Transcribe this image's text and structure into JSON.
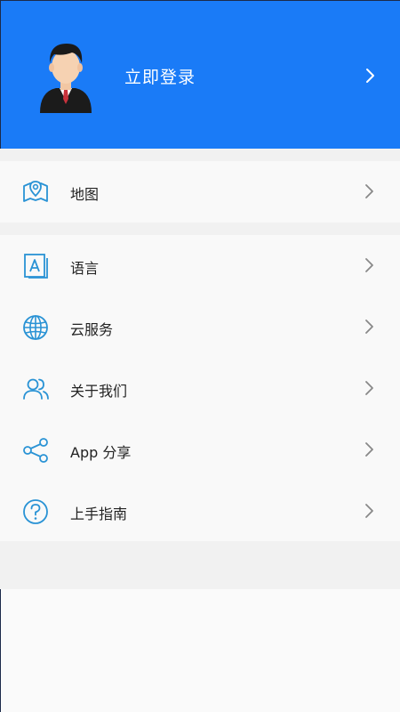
{
  "header": {
    "login_label": "立即登录",
    "background": "#1a7bf7"
  },
  "menu": {
    "map": {
      "label": "地图",
      "icon": "map-pin-icon"
    },
    "language": {
      "label": "语言",
      "icon": "language-icon"
    },
    "cloud": {
      "label": "云服务",
      "icon": "globe-icon"
    },
    "about": {
      "label": "关于我们",
      "icon": "users-icon"
    },
    "share": {
      "label": "App 分享",
      "icon": "share-icon"
    },
    "guide": {
      "label": "上手指南",
      "icon": "question-icon"
    }
  },
  "colors": {
    "icon": "#2a93d5",
    "chevron": "#888888"
  }
}
